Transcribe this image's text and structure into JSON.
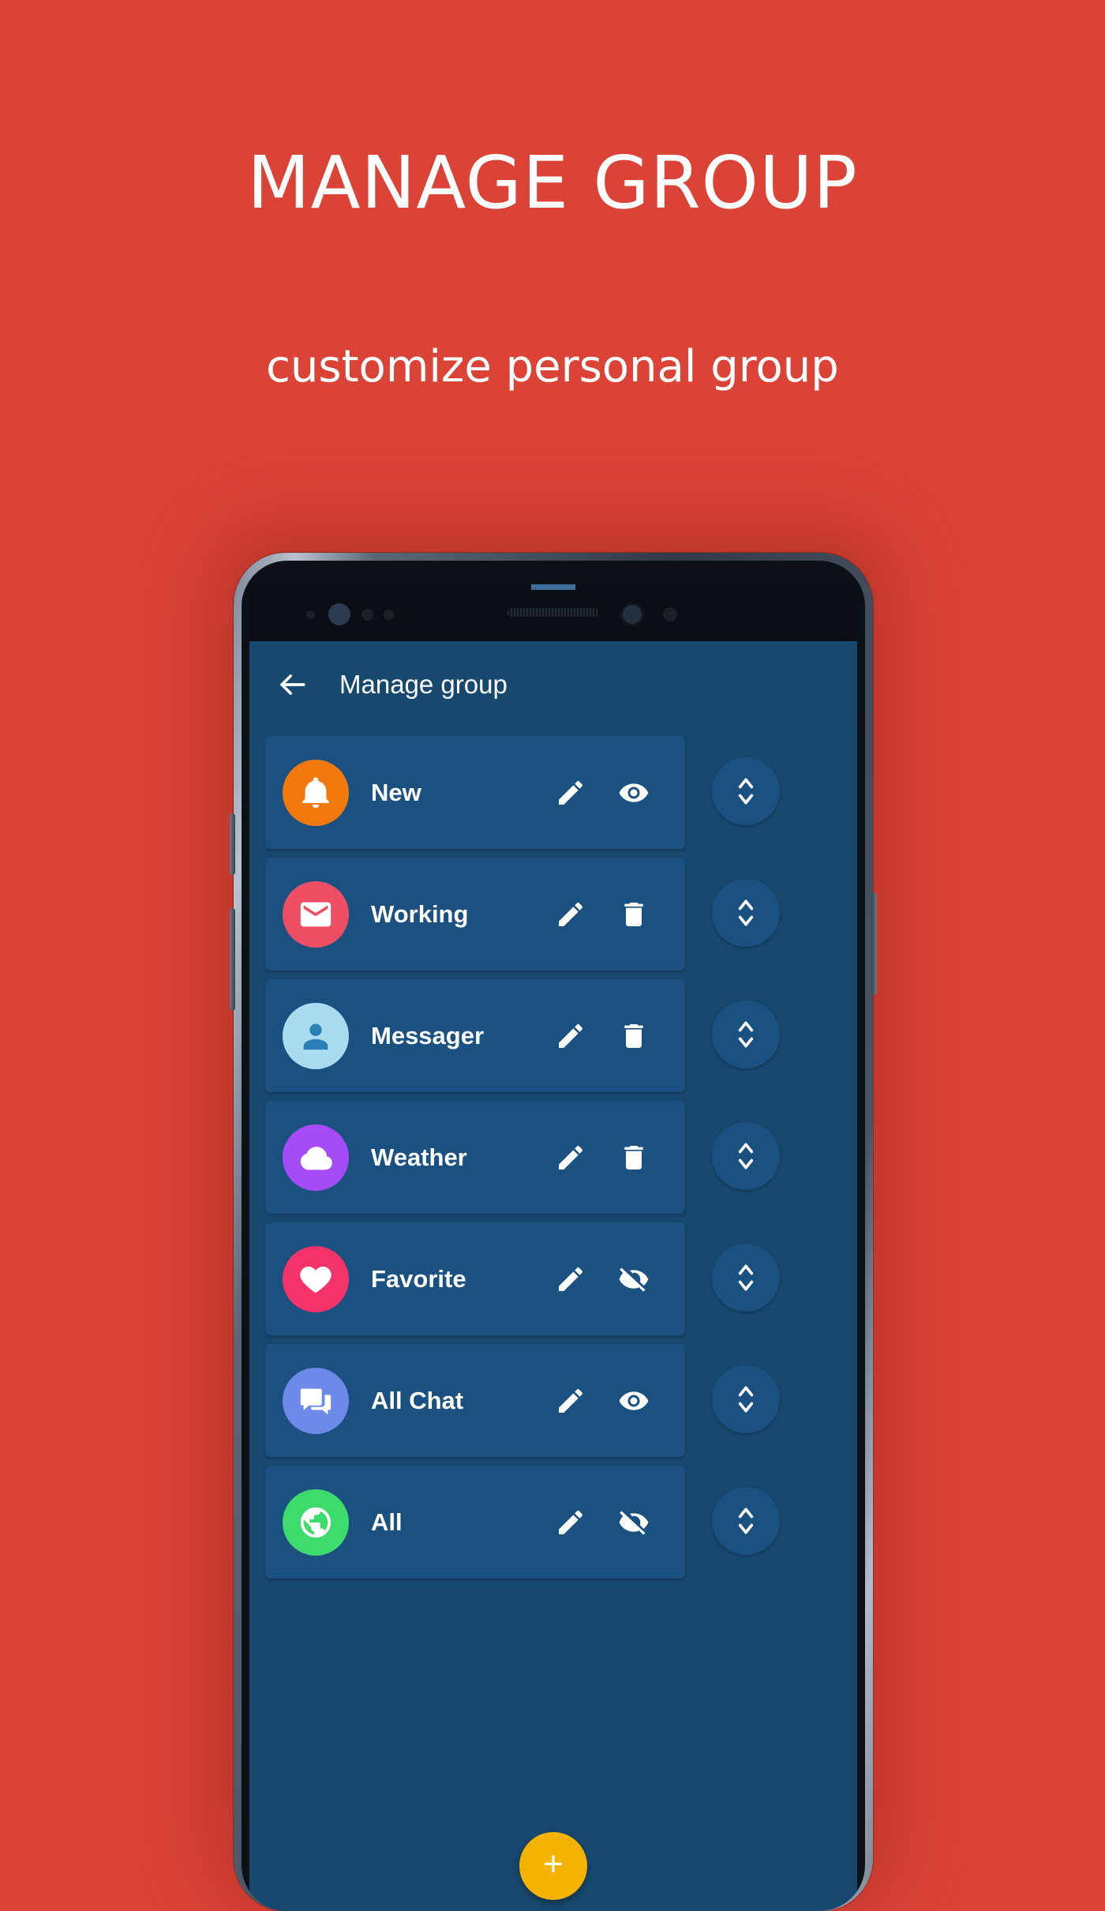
{
  "promo": {
    "headline": "MANAGE GROUP",
    "subheadline": "customize personal group",
    "background_color": "#dc4337"
  },
  "app": {
    "appbar": {
      "back_icon": "arrow-left-icon",
      "title": "Manage group"
    },
    "screen_background": "#17496f",
    "card_background": "#1b5181",
    "fab": {
      "label": "+",
      "icon": "plus-icon",
      "color": "#f5b301"
    },
    "groups": [
      {
        "name": "New",
        "icon": "bell-icon",
        "avatar_color": "#f4790d",
        "edit_icon": "pencil-icon",
        "action_icon": "eye-icon",
        "drag_icon": "reorder-icon"
      },
      {
        "name": "Working",
        "icon": "mail-icon",
        "avatar_color": "#ef4f63",
        "edit_icon": "pencil-icon",
        "action_icon": "trash-icon",
        "drag_icon": "reorder-icon"
      },
      {
        "name": "Messager",
        "icon": "account-icon",
        "avatar_color": "#aadcf0",
        "edit_icon": "pencil-icon",
        "action_icon": "trash-icon",
        "drag_icon": "reorder-icon"
      },
      {
        "name": "Weather",
        "icon": "cloud-icon",
        "avatar_color": "#a64cf6",
        "edit_icon": "pencil-icon",
        "action_icon": "trash-icon",
        "drag_icon": "reorder-icon"
      },
      {
        "name": "Favorite",
        "icon": "heart-icon",
        "avatar_color": "#f4336b",
        "edit_icon": "pencil-icon",
        "action_icon": "eye-off-icon",
        "drag_icon": "reorder-icon"
      },
      {
        "name": "All Chat",
        "icon": "chat-icon",
        "avatar_color": "#6d8ae8",
        "edit_icon": "pencil-icon",
        "action_icon": "eye-icon",
        "drag_icon": "reorder-icon"
      },
      {
        "name": "All",
        "icon": "globe-icon",
        "avatar_color": "#3ddc6d",
        "edit_icon": "pencil-icon",
        "action_icon": "eye-off-icon",
        "drag_icon": "reorder-icon"
      }
    ]
  }
}
